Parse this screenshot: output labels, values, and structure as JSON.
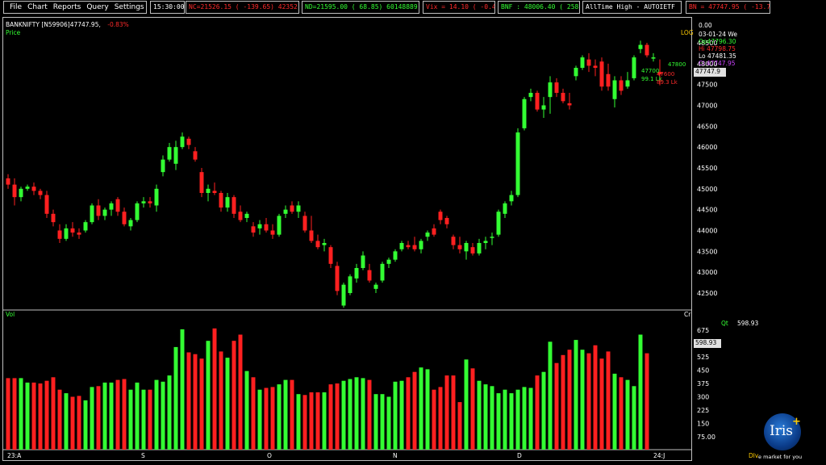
{
  "menu": {
    "items": [
      "File",
      "Chart",
      "Reports",
      "Query",
      "Settings"
    ]
  },
  "tickers": [
    {
      "text": "15:30:00",
      "color": "#ffffff"
    },
    {
      "text": "NC=21526.15 ( -139.65) 42352 Cr.",
      "color": "#ff2a2a"
    },
    {
      "text": "ND=21595.00 ( 68.85) 60148889 Cr.",
      "color": "#33ff33"
    },
    {
      "text": "Vix =  14.10 ( -0.48)",
      "color": "#ff2a2a"
    },
    {
      "text": "BNF : 48006.40 ( 258.45)",
      "color": "#33ff33"
    },
    {
      "text": "AllTime High - AUTOIETF",
      "color": "#ffffff"
    },
    {
      "text": "BN = 47747.95 ( -13.70)",
      "color": "#ff2a2a"
    }
  ],
  "chart": {
    "symbol": "BANKNIFTY [N59906]",
    "last": "47747.95,",
    "change": "-0.83%",
    "price_label": "Price",
    "log_label": "LOG",
    "vol_label": "Vol",
    "cr_label": "Cr",
    "qt_label": "Qt",
    "qt_value": "598.93",
    "vol_box": "598.93",
    "price_box": "47747.9",
    "ohlc": {
      "top": "0.00",
      "date": "03-01-24 We",
      "open": "Op47796.30",
      "high": "Hi 47798.75",
      "low": "Lo 47481.35",
      "close": "Cl 47747.95"
    },
    "overlay": {
      "g1": "47700",
      "g2": "99.1 Lk",
      "r0": "47800",
      "r1": "47600",
      "r2": "89.3 Lk"
    },
    "x_labels": [
      "23:A",
      "S",
      "O",
      "N",
      "D",
      "24:J"
    ],
    "dlv": "Dlv"
  },
  "colors": {
    "up": "#33ff33",
    "down": "#ff2020",
    "ohlc_close": "#cc44ff"
  },
  "logo": {
    "text": "Iris",
    "plus": "+",
    "tagline": "e market for you"
  },
  "chart_data": {
    "type": "candlestick",
    "price_axis": [
      42500,
      43000,
      43500,
      44000,
      44500,
      45000,
      45500,
      46000,
      46500,
      47000,
      47500,
      48000,
      48500
    ],
    "volume_axis": [
      75,
      150,
      225,
      300,
      375,
      450,
      525,
      600,
      675
    ],
    "ylim_price": [
      42100,
      48750
    ],
    "ylim_volume": [
      0,
      700
    ],
    "candles": [
      [
        45250,
        45350,
        45000,
        45100
      ],
      [
        45100,
        45250,
        44600,
        44800
      ],
      [
        44800,
        45050,
        44700,
        45000
      ],
      [
        45000,
        45100,
        44950,
        45050
      ],
      [
        45050,
        45150,
        44850,
        44950
      ],
      [
        44950,
        45000,
        44750,
        44850
      ],
      [
        44850,
        44950,
        44300,
        44400
      ],
      [
        44400,
        44500,
        44100,
        44200
      ],
      [
        44000,
        44150,
        43700,
        43800
      ],
      [
        43800,
        44150,
        43750,
        44050
      ],
      [
        44050,
        44200,
        43850,
        43950
      ],
      [
        43950,
        44050,
        43800,
        43900
      ],
      [
        44000,
        44250,
        43950,
        44200
      ],
      [
        44200,
        44650,
        44150,
        44600
      ],
      [
        44600,
        44750,
        44250,
        44350
      ],
      [
        44350,
        44550,
        44250,
        44500
      ],
      [
        44500,
        44700,
        44350,
        44650
      ],
      [
        44750,
        44800,
        44350,
        44450
      ],
      [
        44450,
        44550,
        44100,
        44150
      ],
      [
        44100,
        44300,
        44000,
        44250
      ],
      [
        44250,
        44700,
        44200,
        44650
      ],
      [
        44650,
        44800,
        44550,
        44700
      ],
      [
        44700,
        44800,
        44550,
        44650
      ],
      [
        44600,
        45100,
        44450,
        45000
      ],
      [
        45400,
        45800,
        45300,
        45700
      ],
      [
        45700,
        46100,
        45650,
        46000
      ],
      [
        45600,
        46150,
        45450,
        46000
      ],
      [
        46000,
        46350,
        45950,
        46250
      ],
      [
        46200,
        46250,
        45950,
        46050
      ],
      [
        45900,
        46000,
        45650,
        45700
      ],
      [
        45400,
        45500,
        44800,
        44900
      ],
      [
        44900,
        45100,
        44700,
        45000
      ],
      [
        44950,
        45150,
        44850,
        44900
      ],
      [
        44900,
        44950,
        44450,
        44550
      ],
      [
        44550,
        44900,
        44450,
        44800
      ],
      [
        44800,
        44850,
        44300,
        44400
      ],
      [
        44450,
        44600,
        44200,
        44250
      ],
      [
        44300,
        44450,
        44200,
        44400
      ],
      [
        44100,
        44200,
        43850,
        43950
      ],
      [
        44050,
        44250,
        43900,
        44150
      ],
      [
        44150,
        44300,
        43950,
        44000
      ],
      [
        44000,
        44150,
        43800,
        43900
      ],
      [
        43900,
        44400,
        43850,
        44350
      ],
      [
        44400,
        44600,
        44300,
        44500
      ],
      [
        44600,
        44700,
        44400,
        44450
      ],
      [
        44450,
        44700,
        44300,
        44600
      ],
      [
        44350,
        44450,
        43950,
        44000
      ],
      [
        44000,
        44350,
        43700,
        43750
      ],
      [
        43750,
        43900,
        43550,
        43600
      ],
      [
        43650,
        43800,
        43500,
        43700
      ],
      [
        43600,
        43650,
        43100,
        43200
      ],
      [
        43150,
        43250,
        42450,
        42550
      ],
      [
        42200,
        42750,
        42150,
        42700
      ],
      [
        42500,
        42950,
        42450,
        42900
      ],
      [
        42850,
        43200,
        42750,
        43100
      ],
      [
        43100,
        43500,
        43050,
        43400
      ],
      [
        43050,
        43200,
        42750,
        42800
      ],
      [
        42600,
        42750,
        42500,
        42700
      ],
      [
        42800,
        43250,
        42750,
        43200
      ],
      [
        43200,
        43350,
        43100,
        43300
      ],
      [
        43300,
        43550,
        43250,
        43500
      ],
      [
        43550,
        43750,
        43500,
        43700
      ],
      [
        43650,
        43750,
        43550,
        43600
      ],
      [
        43650,
        43850,
        43500,
        43550
      ],
      [
        43550,
        43800,
        43450,
        43750
      ],
      [
        43850,
        44000,
        43750,
        43950
      ],
      [
        44050,
        44150,
        43850,
        43900
      ],
      [
        44450,
        44500,
        44150,
        44250
      ],
      [
        44300,
        44350,
        44050,
        44150
      ],
      [
        43850,
        43900,
        43550,
        43650
      ],
      [
        43650,
        43850,
        43450,
        43550
      ],
      [
        43500,
        43750,
        43300,
        43700
      ],
      [
        43600,
        43700,
        43400,
        43450
      ],
      [
        43450,
        43800,
        43400,
        43700
      ],
      [
        43700,
        43850,
        43550,
        43750
      ],
      [
        43850,
        43950,
        43650,
        43850
      ],
      [
        43900,
        44500,
        43850,
        44450
      ],
      [
        44400,
        44700,
        44300,
        44650
      ],
      [
        44700,
        44950,
        44600,
        44850
      ],
      [
        44850,
        46450,
        44800,
        46350
      ],
      [
        46450,
        47200,
        46400,
        47150
      ],
      [
        47200,
        47400,
        47100,
        47300
      ],
      [
        47300,
        47350,
        46850,
        46900
      ],
      [
        46900,
        47200,
        46700,
        47000
      ],
      [
        47200,
        47700,
        46800,
        47550
      ],
      [
        47550,
        47650,
        47200,
        47300
      ],
      [
        47300,
        47400,
        47050,
        47100
      ],
      [
        47050,
        47300,
        46900,
        47000
      ],
      [
        47700,
        47950,
        47600,
        47900
      ],
      [
        47900,
        48200,
        47850,
        48150
      ],
      [
        48100,
        48250,
        47800,
        47950
      ],
      [
        47950,
        48100,
        47700,
        47900
      ],
      [
        48050,
        48150,
        47350,
        47450
      ],
      [
        47750,
        48000,
        47350,
        47450
      ],
      [
        47150,
        47700,
        46950,
        47600
      ],
      [
        47600,
        47700,
        47250,
        47350
      ],
      [
        47450,
        47800,
        47400,
        47600
      ],
      [
        47650,
        48200,
        47600,
        48150
      ],
      [
        48350,
        48550,
        48250,
        48450
      ],
      [
        48450,
        48500,
        48150,
        48200
      ],
      [
        48150,
        48250,
        48050,
        48150
      ],
      [
        47796.3,
        48100,
        47481.35,
        47747.95
      ]
    ],
    "volumes": [
      405,
      405,
      405,
      380,
      380,
      375,
      390,
      410,
      340,
      320,
      300,
      305,
      280,
      355,
      360,
      380,
      380,
      395,
      400,
      340,
      380,
      340,
      340,
      395,
      385,
      420,
      580,
      680,
      550,
      540,
      515,
      615,
      685,
      555,
      520,
      615,
      650,
      445,
      410,
      340,
      350,
      355,
      370,
      395,
      395,
      315,
      310,
      325,
      325,
      325,
      370,
      375,
      390,
      400,
      410,
      405,
      395,
      315,
      315,
      300,
      385,
      390,
      410,
      440,
      465,
      455,
      340,
      355,
      420,
      420,
      270,
      510,
      460,
      390,
      370,
      360,
      320,
      340,
      320,
      340,
      355,
      350,
      420,
      440,
      610,
      490,
      535,
      565,
      620,
      565,
      545,
      590,
      515,
      555,
      430,
      410,
      395,
      360,
      650,
      545
    ]
  }
}
